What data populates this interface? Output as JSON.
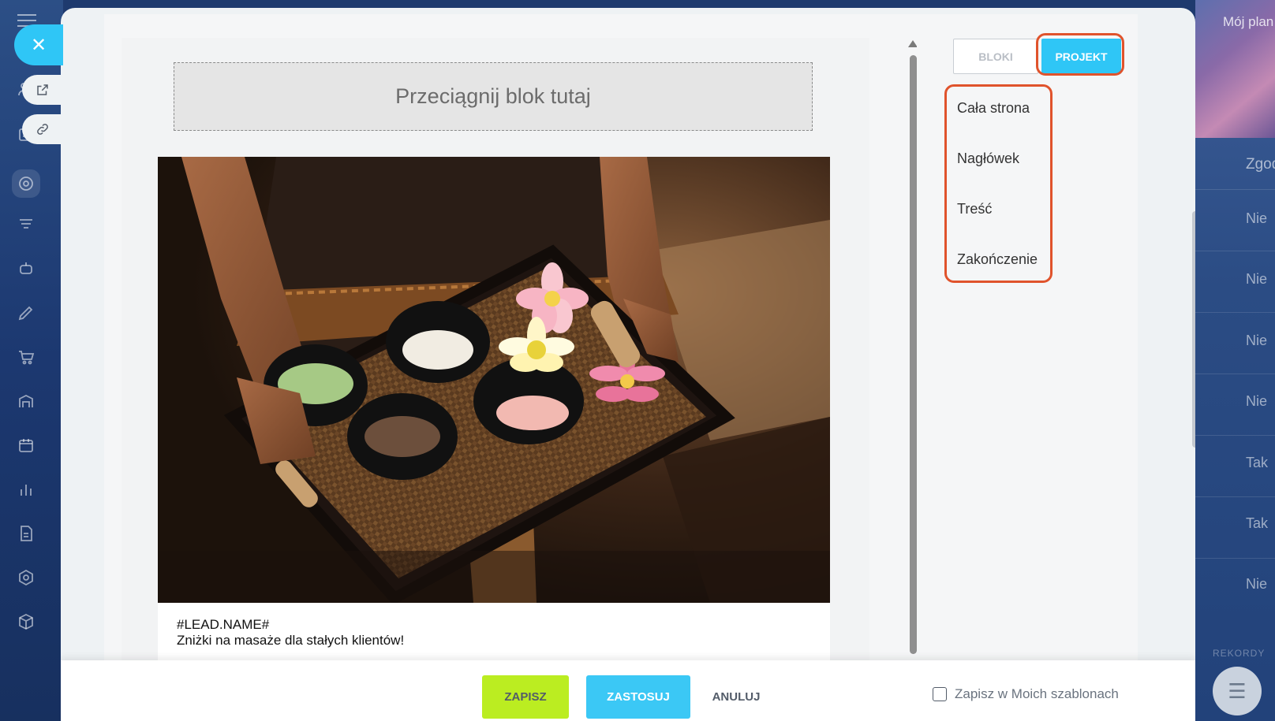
{
  "background": {
    "my_plan": "Mój plan",
    "column_header": "Zgoda",
    "column_values": [
      "Nie",
      "Nie",
      "Nie",
      "Nie",
      "Tak",
      "Tak",
      "Nie"
    ],
    "footer_label": "REKORDY"
  },
  "editor": {
    "dropzone_text": "Przeciągnij blok tutaj",
    "lead_name": "#LEAD.NAME#",
    "lead_text": "Zniżki na masaże dla stałych klientów!"
  },
  "panel": {
    "tab_bloki": "BLOKI",
    "tab_projekt": "PROJEKT",
    "menu": [
      "Cała strona",
      "Nagłówek",
      "Treść",
      "Zakończenie"
    ]
  },
  "footer": {
    "save": "ZAPISZ",
    "apply": "ZASTOSUJ",
    "cancel": "ANULUJ",
    "save_template": "Zapisz w Moich szablonach"
  },
  "colors": {
    "accent_blue": "#2fc6f6",
    "save_green": "#bbed21",
    "highlight": "#e0532c"
  }
}
